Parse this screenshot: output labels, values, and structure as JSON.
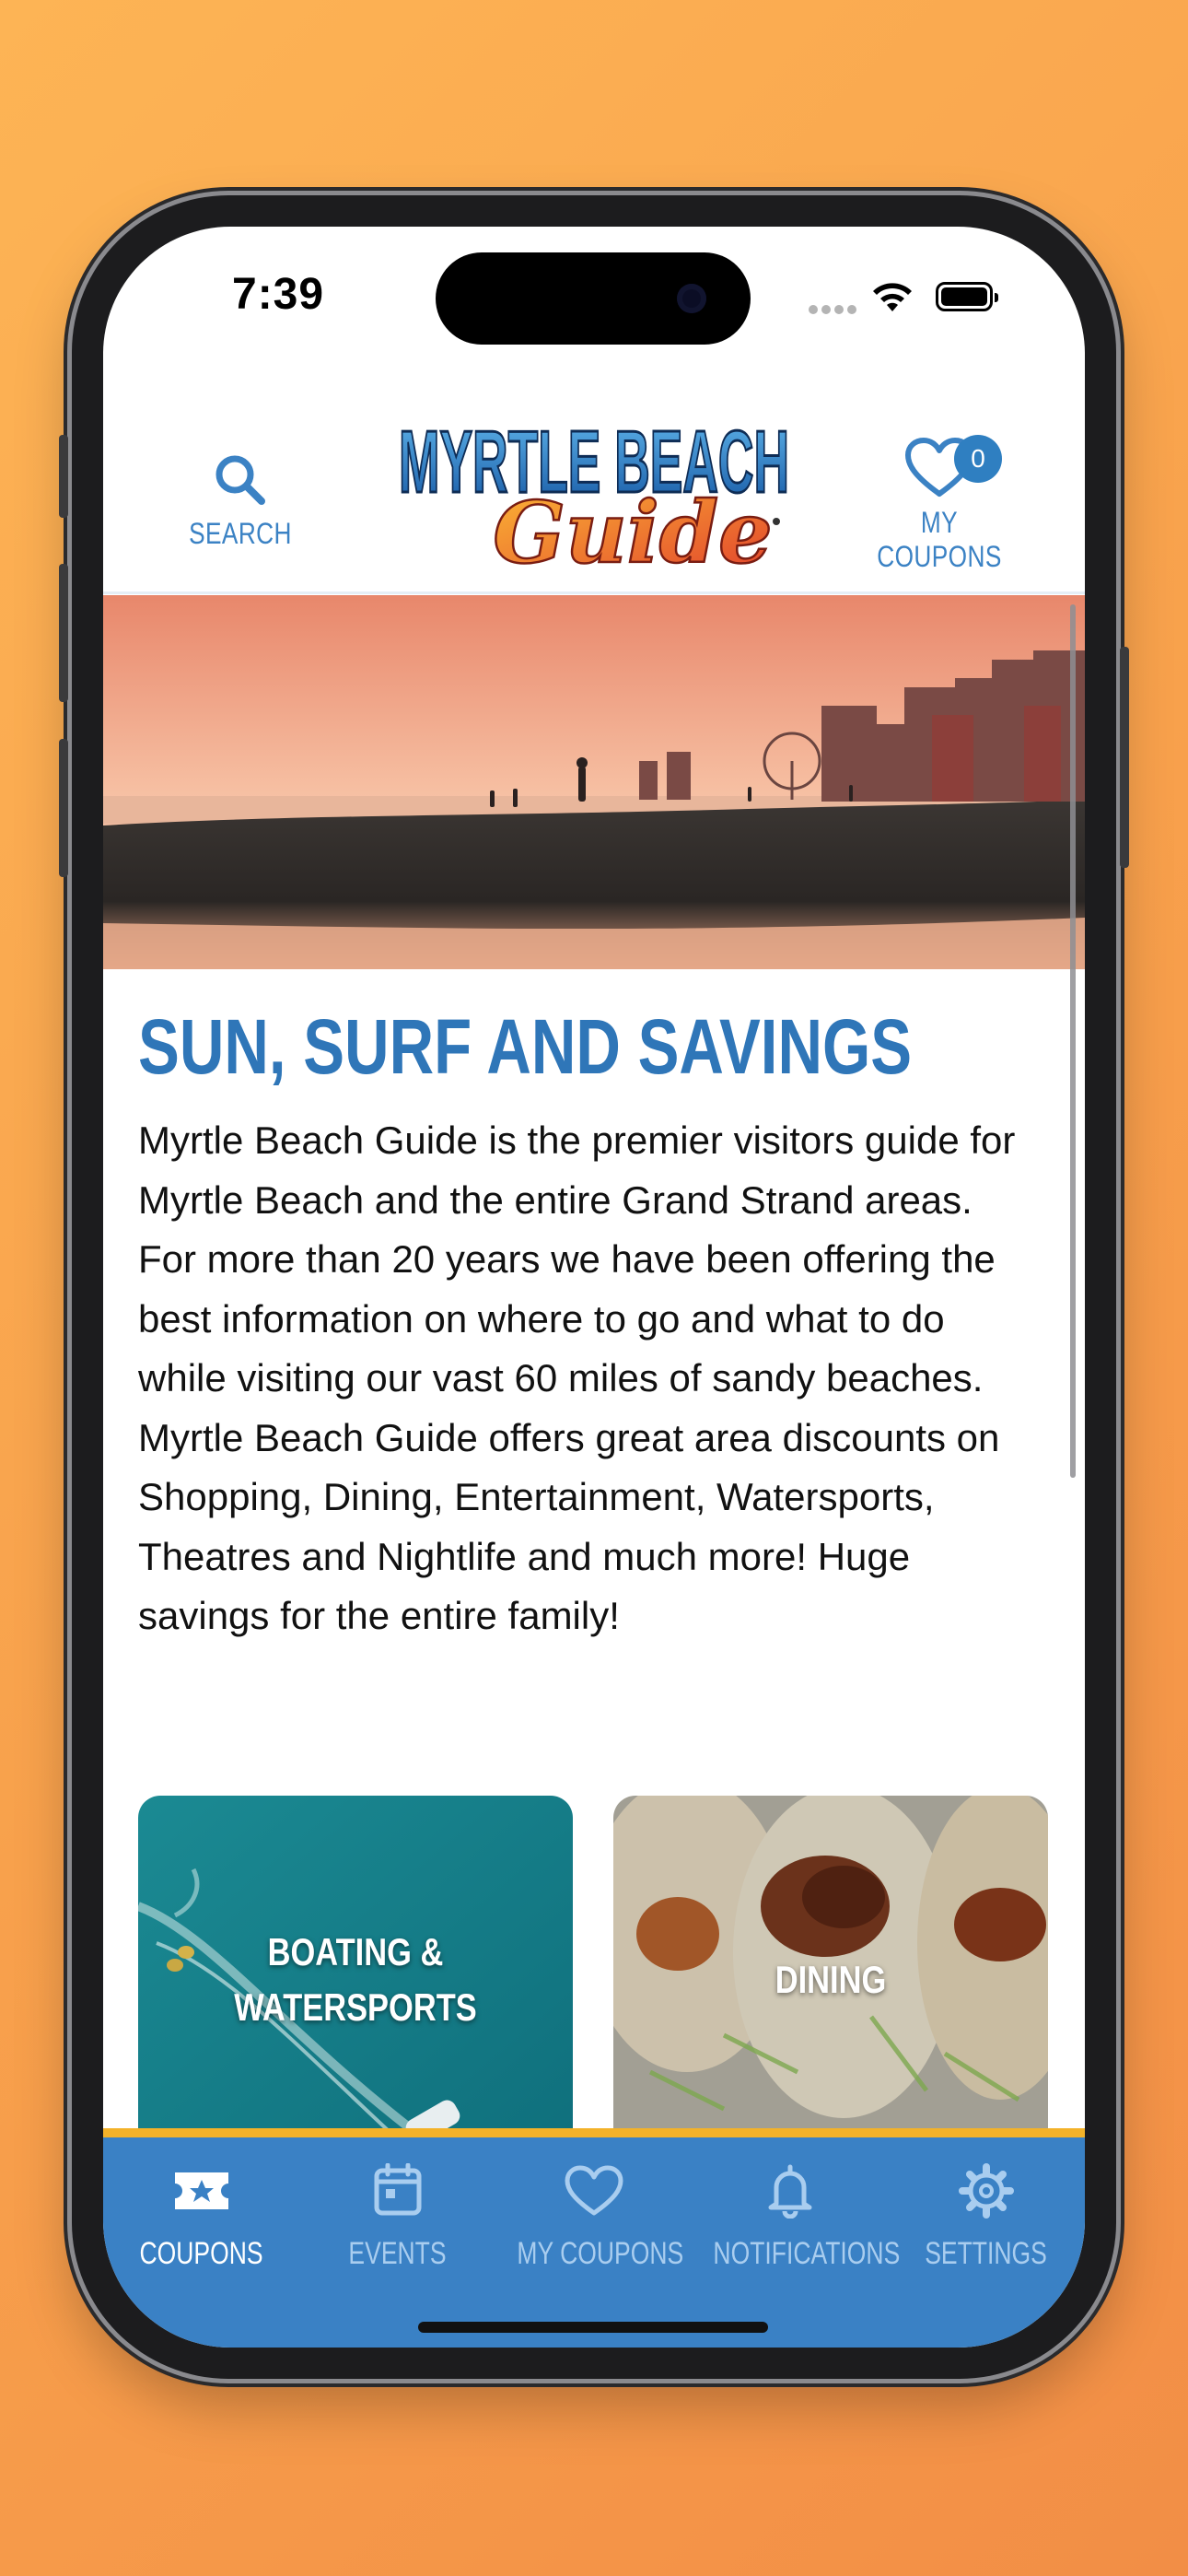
{
  "status_bar": {
    "time": "7:39"
  },
  "header": {
    "search_label": "SEARCH",
    "my_coupons_label": "MY COUPONS",
    "coupon_count": "0",
    "logo": {
      "line1": "MYRTLE BEACH",
      "line2": "Guide"
    }
  },
  "main": {
    "headline": "SUN, SURF AND SAVINGS",
    "description": "Myrtle Beach Guide is the premier visitors guide for Myrtle Beach and the entire Grand Strand areas. For more than 20 years we have been offering the best information on where to go and what to do while visiting our vast 60 miles of sandy beaches. Myrtle Beach Guide offers great area discounts on Shopping, Dining, Entertainment, Watersports, Theatres and Nightlife and much more! Huge savings for the entire family!",
    "tiles": [
      {
        "line1": "BOATING &",
        "line2": "WATERSPORTS"
      },
      {
        "label": "DINING"
      }
    ]
  },
  "tabbar": {
    "items": [
      {
        "label": "COUPONS",
        "icon": "ticket-star-icon",
        "active": true
      },
      {
        "label": "EVENTS",
        "icon": "calendar-icon",
        "active": false
      },
      {
        "label": "MY COUPONS",
        "icon": "heart-icon",
        "active": false
      },
      {
        "label": "NOTIFICATIONS",
        "icon": "bell-icon",
        "active": false
      },
      {
        "label": "SETTINGS",
        "icon": "gear-icon",
        "active": false
      }
    ]
  },
  "colors": {
    "brand_blue": "#3a81c5",
    "headline_blue": "#2f76b8",
    "tabbar_accent": "#f3b229",
    "background_orange": "#f8a14c"
  }
}
